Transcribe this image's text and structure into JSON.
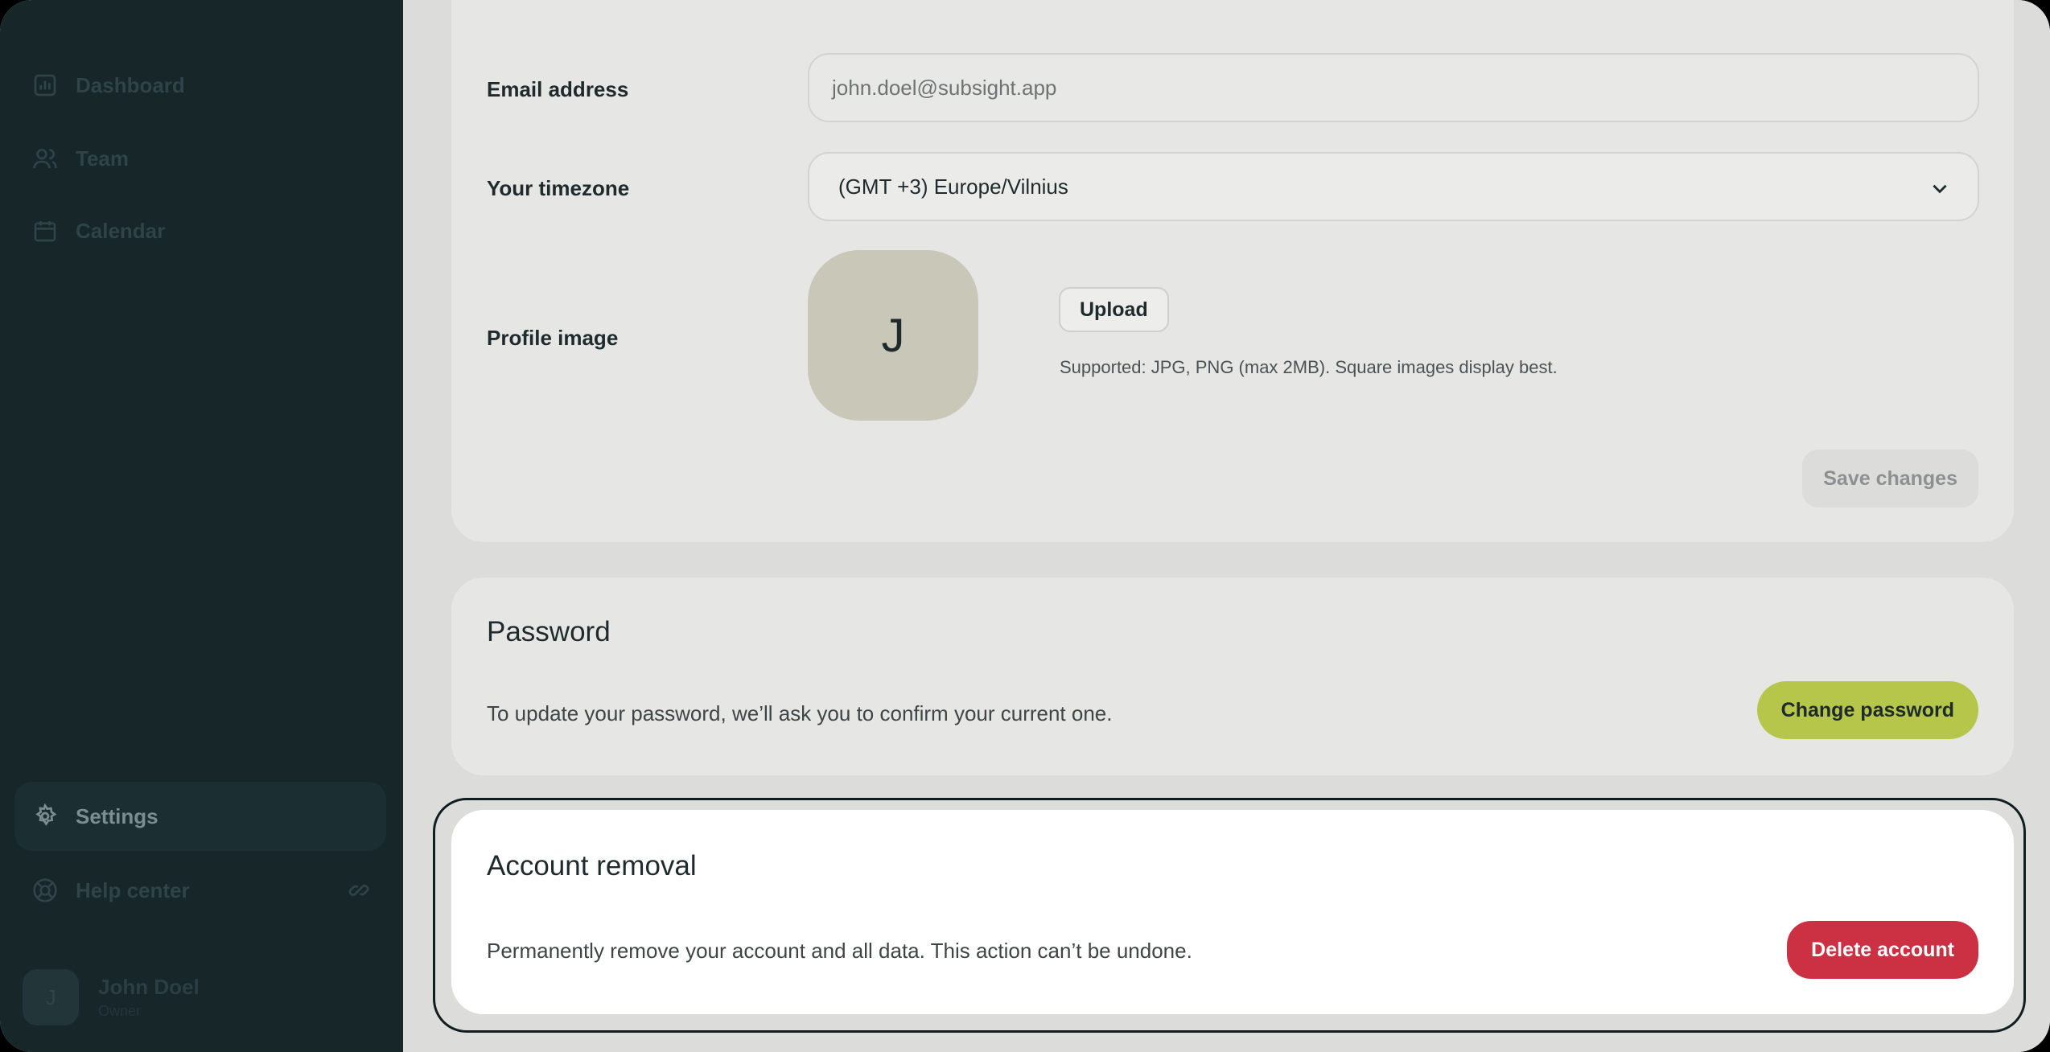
{
  "sidebar": {
    "items": [
      {
        "label": "Dashboard",
        "icon": "bar-chart-icon"
      },
      {
        "label": "Team",
        "icon": "users-icon"
      },
      {
        "label": "Calendar",
        "icon": "calendar-icon"
      }
    ],
    "settings_label": "Settings",
    "help_label": "Help center",
    "user": {
      "initial": "J",
      "name": "John Doel",
      "role": "Owner"
    }
  },
  "profile": {
    "email_label": "Email address",
    "email_value": "john.doel@subsight.app",
    "timezone_label": "Your timezone",
    "timezone_value": "(GMT +3) Europe/Vilnius",
    "image_label": "Profile image",
    "avatar_initial": "J",
    "upload_label": "Upload",
    "upload_hint": "Supported: JPG, PNG (max 2MB). Square images display best.",
    "save_label": "Save changes"
  },
  "password": {
    "title": "Password",
    "description": "To update your password, we’ll ask you to confirm your current one.",
    "button_label": "Change password"
  },
  "removal": {
    "title": "Account removal",
    "description": "Permanently remove your account and all data. This action can’t be undone.",
    "button_label": "Delete account"
  },
  "colors": {
    "sidebar_bg": "#162629",
    "accent_green": "#b6c64a",
    "danger_red": "#cc3143",
    "page_bg": "#dcdcda"
  }
}
